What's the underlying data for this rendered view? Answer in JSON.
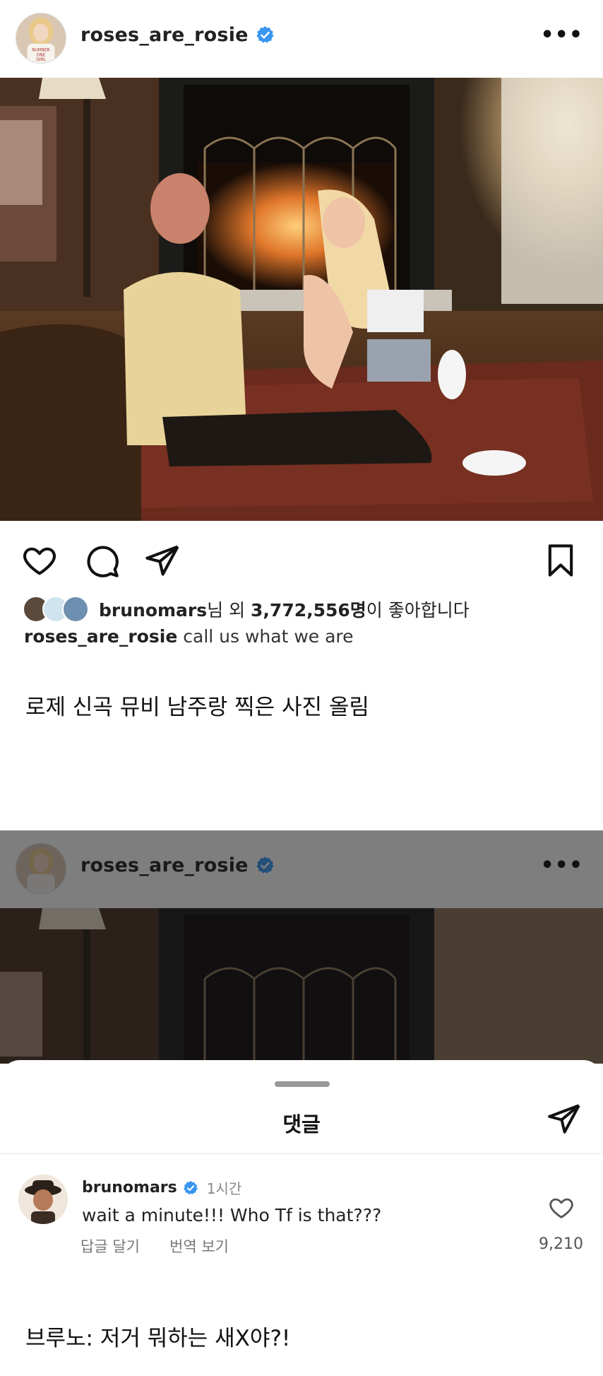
{
  "post": {
    "username": "roses_are_rosie",
    "more_label": "•••",
    "likes": {
      "liker": "brunomars",
      "mid": "님 외 ",
      "count": "3,772,556명",
      "suffix": "이 좋아합니다"
    },
    "caption": {
      "username": "roses_are_rosie",
      "text": "call us what we are"
    }
  },
  "commentary_top": "로제 신곡 뮤비 남주랑 찍은 사진 올림",
  "screen2": {
    "username": "roses_are_rosie",
    "more_label": "•••"
  },
  "comments_sheet": {
    "title": "댓글",
    "comment": {
      "username": "brunomars",
      "time": "1시간",
      "text": "wait a minute!!! Who Tf is that???",
      "reply_label": "답글 달기",
      "translate_label": "번역 보기",
      "like_count": "9,210"
    }
  },
  "commentary_bottom": "브루노: 저거 뭐하는 새X야?!",
  "icons": [
    "heart-icon",
    "comment-icon",
    "share-icon",
    "bookmark-icon",
    "verified-icon",
    "more-icon"
  ],
  "colors": {
    "verified": "#3897f0",
    "text": "#111111",
    "muted": "#777777"
  }
}
